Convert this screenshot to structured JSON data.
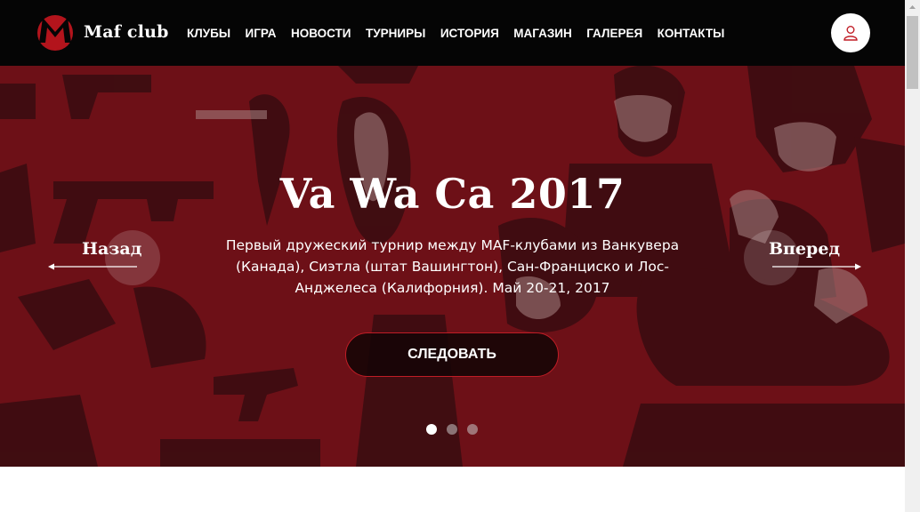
{
  "header": {
    "brand": "Maf club",
    "nav": [
      "КЛУБЫ",
      "ИГРА",
      "НОВОСТИ",
      "ТУРНИРЫ",
      "ИСТОРИЯ",
      "МАГАЗИН",
      "ГАЛЕРЕЯ",
      "КОНТАКТЫ"
    ],
    "user_icon": "user-icon"
  },
  "hero": {
    "title": "Va Wa Ca 2017",
    "description": "Первый дружеский турнир между MAF-клубами из Ванкувера (Канада), Сиэтла (штат Вашингтон), Сан-Франциско и Лос-Анджелеса (Калифорния). Май 20-21, 2017",
    "button": "СЛЕДОВАТЬ",
    "prev_label": "Назад",
    "next_label": "Вперед",
    "slide_count": 3,
    "active_slide": 1
  },
  "colors": {
    "header_bg": "#050505",
    "hero_bg": "#6e1018",
    "accent": "#c01d26"
  }
}
